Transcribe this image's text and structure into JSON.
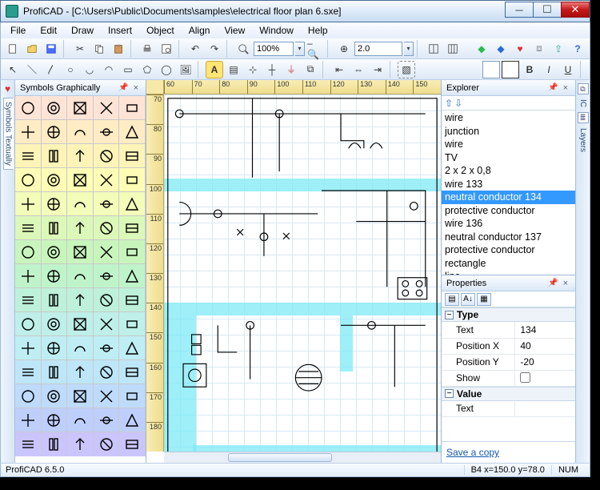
{
  "app": {
    "name": "ProfiCAD",
    "document_path": "[C:\\Users\\Public\\Documents\\samples\\electrical floor plan 6.sxe]"
  },
  "menu": [
    "File",
    "Edit",
    "Draw",
    "Insert",
    "Object",
    "Align",
    "View",
    "Window",
    "Help"
  ],
  "zoom": {
    "pct": "100%",
    "scale": "2.0"
  },
  "leftTabs": {
    "active": "Symbols Textually",
    "items": [
      "Symbols Textually"
    ]
  },
  "rightTabs": [
    "IC",
    "Layers"
  ],
  "panels": {
    "symbols": "Symbols Graphically",
    "explorer": "Explorer",
    "properties": "Properties"
  },
  "rulers": {
    "h": [
      "60",
      "70",
      "80",
      "90",
      "100",
      "110",
      "120",
      "130",
      "140",
      "150"
    ],
    "v": [
      "70",
      "80",
      "90",
      "100",
      "110",
      "120",
      "130",
      "140",
      "150",
      "160",
      "170",
      "180"
    ]
  },
  "explorer": {
    "items": [
      "wire",
      "junction",
      "wire",
      "TV",
      "2 x 2 x 0,8",
      "wire 133",
      "neutral conductor 134",
      "protective conductor",
      "wire 136",
      "neutral conductor 137",
      "protective conductor",
      "rectangle",
      "line"
    ],
    "selected": "neutral conductor 134"
  },
  "properties": {
    "groups": [
      {
        "name": "Type",
        "rows": [
          {
            "k": "Text",
            "v": "134"
          },
          {
            "k": "Position X",
            "v": "40"
          },
          {
            "k": "Position Y",
            "v": "-20"
          },
          {
            "k": "Show",
            "v": "",
            "checkbox": true
          }
        ]
      },
      {
        "name": "Value",
        "rows": [
          {
            "k": "Text",
            "v": ""
          }
        ]
      }
    ],
    "link": "Save a copy"
  },
  "status": {
    "product": "ProfiCAD 6.5.0",
    "coord": "B4  x=150.0  y=78.0",
    "num": "NUM"
  }
}
